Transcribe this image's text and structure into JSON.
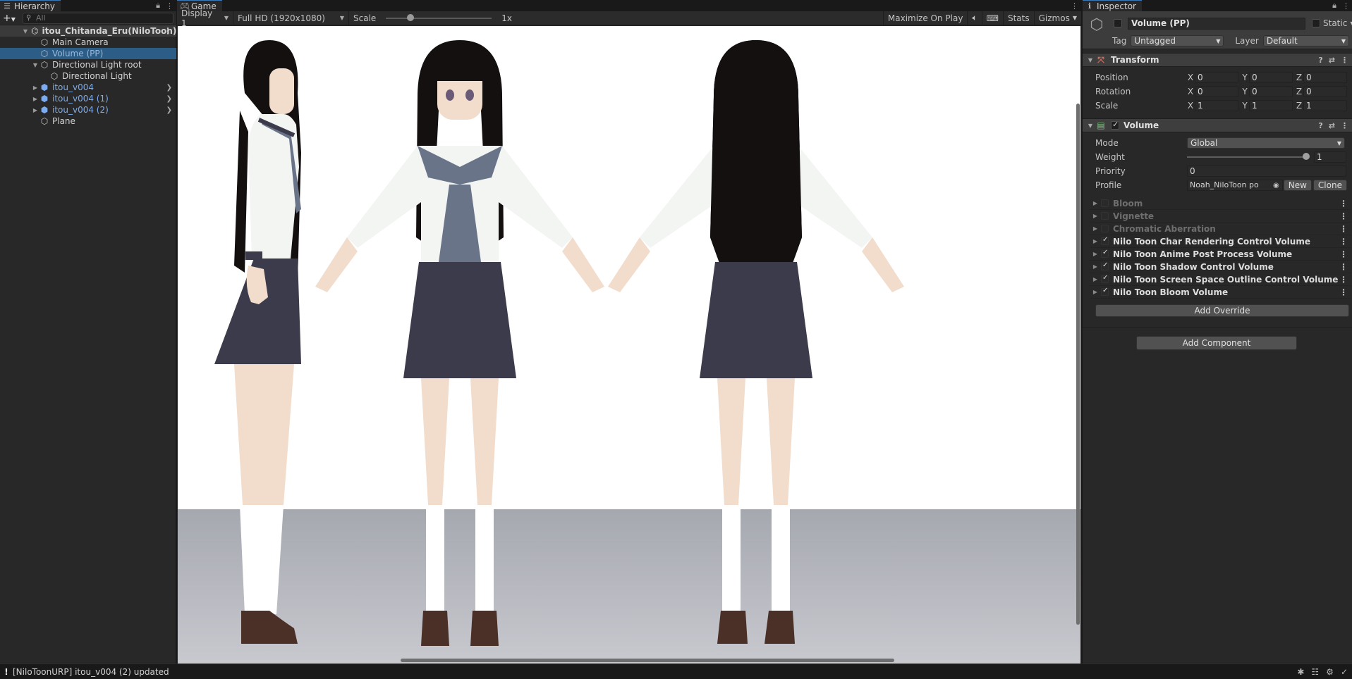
{
  "hierarchy": {
    "tab_label": "Hierarchy",
    "add_label": "+",
    "search_placeholder": "All",
    "items": [
      {
        "label": "itou_Chitanda_Eru(NiloToon)",
        "type": "scene"
      },
      {
        "label": "Main Camera",
        "type": "object"
      },
      {
        "label": "Volume (PP)",
        "type": "object",
        "selected": true
      },
      {
        "label": "Directional Light root",
        "type": "object"
      },
      {
        "label": "Directional Light",
        "type": "object"
      },
      {
        "label": "itou_v004",
        "type": "prefab"
      },
      {
        "label": "itou_v004 (1)",
        "type": "prefab"
      },
      {
        "label": "itou_v004 (2)",
        "type": "prefab"
      },
      {
        "label": "Plane",
        "type": "object"
      }
    ]
  },
  "game": {
    "tab_label": "Game",
    "display": "Display 1",
    "resolution": "Full HD (1920x1080)",
    "scale_label": "Scale",
    "scale_value": "1x",
    "maximize": "Maximize On Play",
    "stats": "Stats",
    "gizmos": "Gizmos"
  },
  "inspector": {
    "tab_label": "Inspector",
    "object_name": "Volume (PP)",
    "static_label": "Static",
    "tag_label": "Tag",
    "tag_value": "Untagged",
    "layer_label": "Layer",
    "layer_value": "Default",
    "transform": {
      "title": "Transform",
      "position_label": "Position",
      "rotation_label": "Rotation",
      "scale_label": "Scale",
      "position": {
        "x": "0",
        "y": "0",
        "z": "0"
      },
      "rotation": {
        "x": "0",
        "y": "0",
        "z": "0"
      },
      "scale": {
        "x": "1",
        "y": "1",
        "z": "1"
      }
    },
    "volume": {
      "title": "Volume",
      "mode_label": "Mode",
      "mode_value": "Global",
      "weight_label": "Weight",
      "weight_value": "1",
      "priority_label": "Priority",
      "priority_value": "0",
      "profile_label": "Profile",
      "profile_value": "Noah_NiloToon po",
      "new_label": "New",
      "clone_label": "Clone",
      "overrides": [
        {
          "label": "Bloom",
          "enabled": false
        },
        {
          "label": "Vignette",
          "enabled": false
        },
        {
          "label": "Chromatic Aberration",
          "enabled": false
        },
        {
          "label": "Nilo Toon Char Rendering Control Volume",
          "enabled": true
        },
        {
          "label": "Nilo Toon Anime Post Process Volume",
          "enabled": true
        },
        {
          "label": "Nilo Toon Shadow Control Volume",
          "enabled": true
        },
        {
          "label": "Nilo Toon Screen Space Outline Control Volume",
          "enabled": true
        },
        {
          "label": "Nilo Toon Bloom Volume",
          "enabled": true
        }
      ],
      "add_override": "Add Override"
    },
    "add_component": "Add Component"
  },
  "status": {
    "message": "[NiloToonURP] itou_v004 (2) updated"
  },
  "axis": {
    "x": "X",
    "y": "Y",
    "z": "Z"
  },
  "colors": {
    "skirt": "#3b3b4c",
    "hair": "#141010",
    "skin": "#f2dccc",
    "shoe": "#4a3026",
    "tie": "#6a7488",
    "blouse": "#f3f5f3"
  }
}
